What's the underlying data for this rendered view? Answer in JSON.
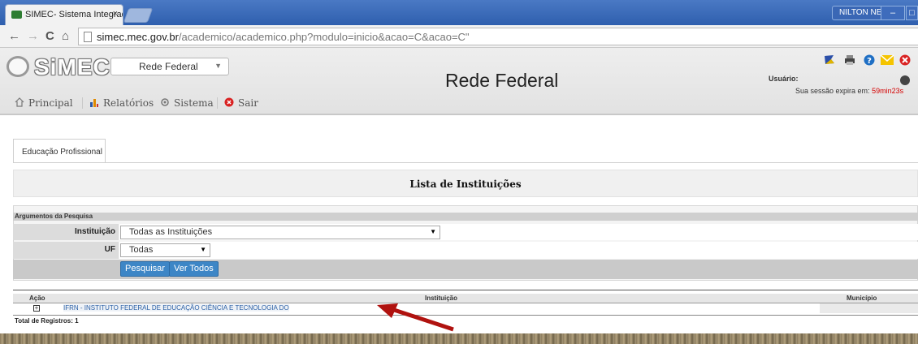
{
  "browser": {
    "tab_title": "SIMEC- Sistema Integrado",
    "tab_close": "×",
    "user_chip": "NILTON NELIO",
    "url_domain": "simec.mec.gov.br",
    "url_path": "/academico/academico.php?modulo=inicio&acao=C&acao=C\""
  },
  "header": {
    "logo_text": "SiMEC",
    "network_select": "Rede Federal",
    "title": "Rede Federal",
    "user_label": "Usuário:",
    "session_prefix": "Sua sessão expira em:",
    "session_time": "59min23s"
  },
  "menu": {
    "principal": "Principal",
    "relatorios": "Relatórios",
    "sistema": "Sistema",
    "sair": "Sair"
  },
  "tabs": {
    "active": "Educação Profissional"
  },
  "list_title": "Lista de Instituições",
  "filters": {
    "heading": "Argumentos da Pesquisa",
    "instituicao_label": "Instituição",
    "instituicao_value": "Todas as Instituições",
    "uf_label": "UF",
    "uf_value": "Todas",
    "search_button": "Pesquisar",
    "view_all_button": "Ver Todos"
  },
  "table": {
    "col_action": "Ação",
    "col_institution": "Instituição",
    "col_municipality": "Município",
    "rows": [
      {
        "institution": "IFRN - INSTITUTO FEDERAL DE EDUCAÇÃO CIÊNCIA E TECNOLOGIA DO",
        "municipality": ""
      }
    ],
    "total": "Total de Registros: 1"
  },
  "colors": {
    "accent_blue": "#3d86c6",
    "session_red": "#d40000",
    "arrow_red": "#b0120f"
  }
}
